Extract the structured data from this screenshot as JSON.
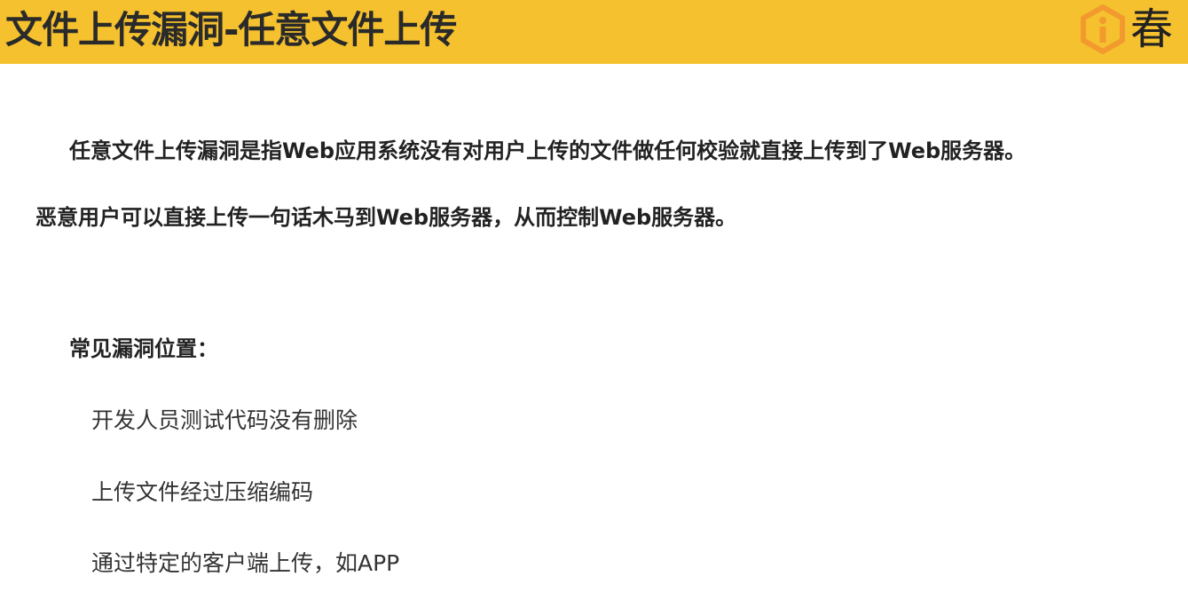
{
  "header": {
    "title": "文件上传漏洞-任意文件上传",
    "logo_text": "春",
    "accent_color": "#f5c12e",
    "logo_color": "#f29a2e"
  },
  "content": {
    "paragraph_1": "任意文件上传漏洞是指Web应用系统没有对用户上传的文件做任何校验就直接上传到了Web服务器。",
    "paragraph_2": "恶意用户可以直接上传一句话木马到Web服务器，从而控制Web服务器。",
    "section_title": "常见漏洞位置：",
    "items": [
      "开发人员测试代码没有删除",
      "上传文件经过压缩编码",
      "通过特定的客户端上传，如APP"
    ]
  }
}
